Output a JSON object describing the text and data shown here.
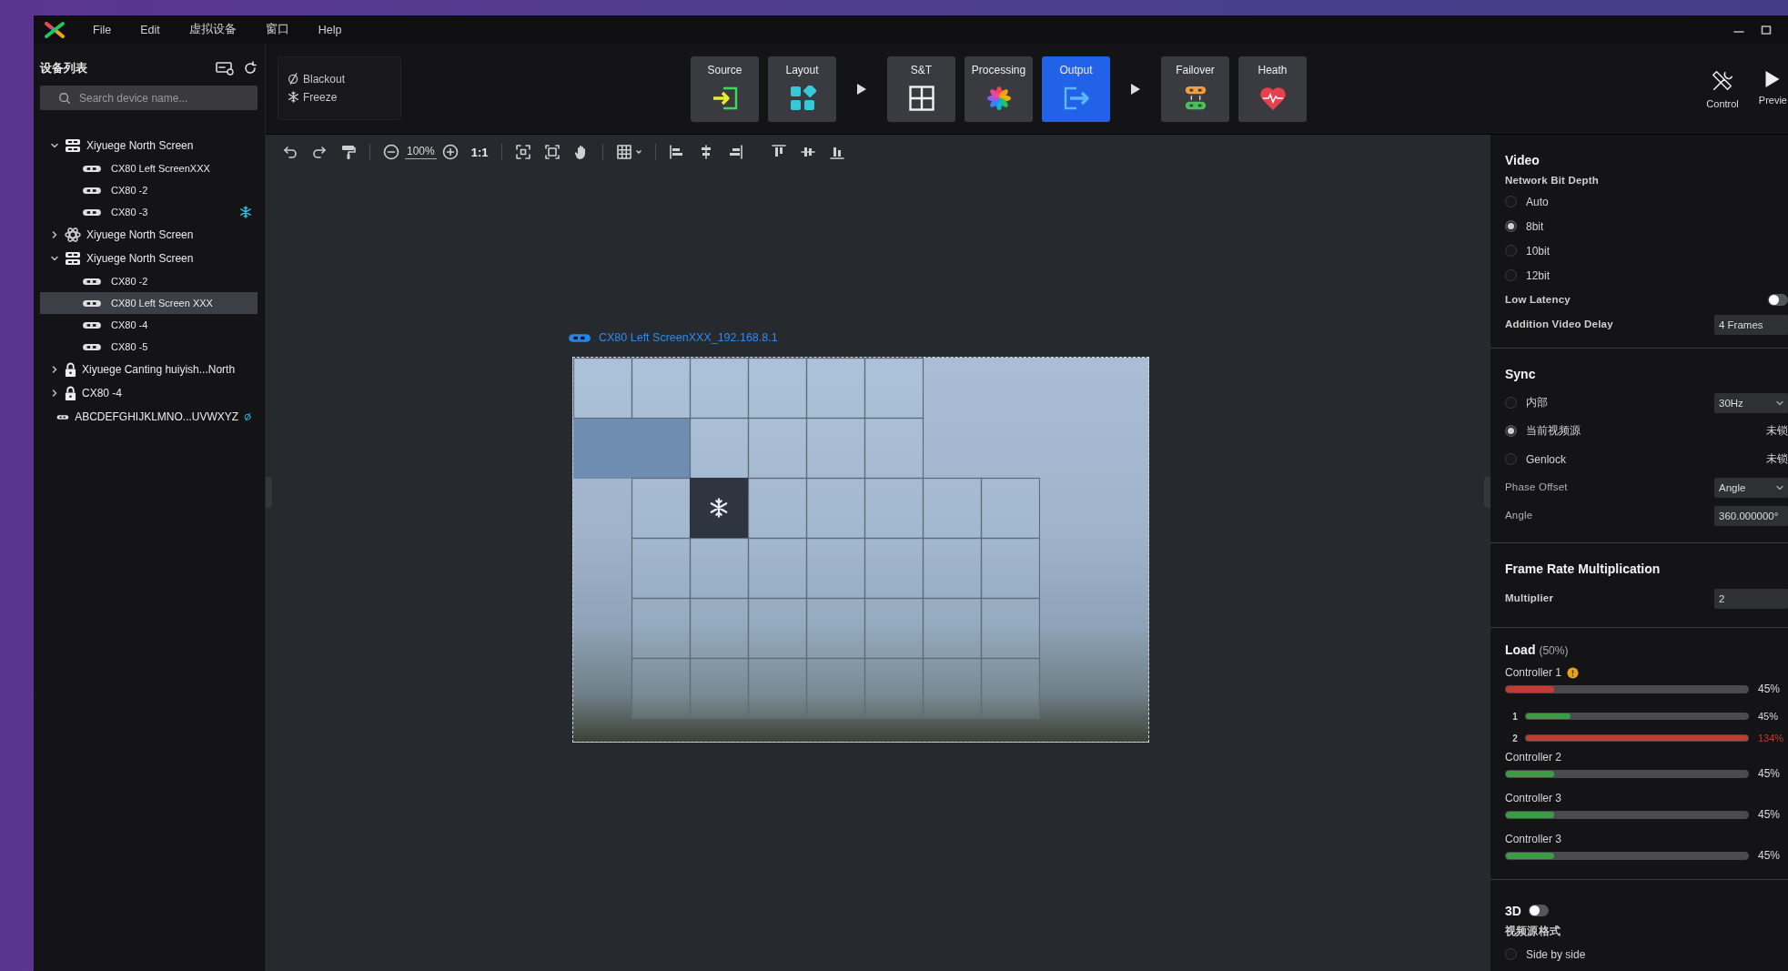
{
  "menu": [
    "File",
    "Edit",
    "虚拟设备",
    "窗口",
    "Help"
  ],
  "sidebar": {
    "title": "设备列表",
    "search": {
      "placeholder": "Search device name..."
    },
    "tree": [
      {
        "label": "Xiyuege North Screen",
        "kind": "group",
        "expanded": true,
        "selected": false,
        "frozen": false,
        "blackout": false,
        "children": [
          {
            "label": "CX80 Left ScreenXXX",
            "kind": "device",
            "selected": false,
            "frozen": false,
            "blackout": false
          },
          {
            "label": "CX80 -2",
            "kind": "device",
            "selected": false,
            "frozen": false,
            "blackout": false
          },
          {
            "label": "CX80 -3",
            "kind": "device",
            "selected": false,
            "frozen": true,
            "blackout": false
          }
        ]
      },
      {
        "label": "Xiyuege North Screen",
        "kind": "cluster",
        "expanded": false,
        "selected": false,
        "frozen": false,
        "blackout": false
      },
      {
        "label": "Xiyuege North Screen",
        "kind": "group",
        "expanded": true,
        "selected": false,
        "frozen": false,
        "blackout": false,
        "children": [
          {
            "label": "CX80 -2",
            "kind": "device",
            "selected": false,
            "frozen": false,
            "blackout": false
          },
          {
            "label": "CX80 Left Screen XXX",
            "kind": "device",
            "selected": true,
            "frozen": false,
            "blackout": false
          },
          {
            "label": "CX80 -4",
            "kind": "device",
            "selected": false,
            "frozen": false,
            "blackout": false
          },
          {
            "label": "CX80 -5",
            "kind": "device",
            "selected": false,
            "frozen": false,
            "blackout": false
          }
        ]
      },
      {
        "label": "Xiyuege Canting huiyish...North",
        "kind": "locked",
        "expanded": false,
        "selected": false,
        "frozen": false,
        "blackout": false
      },
      {
        "label": "CX80 -4",
        "kind": "locked",
        "expanded": false,
        "selected": false,
        "frozen": false,
        "blackout": false
      },
      {
        "label": "ABCDEFGHIJKLMNO...UVWXYZ",
        "kind": "device",
        "selected": false,
        "frozen": false,
        "blackout": true
      }
    ]
  },
  "quick_actions": [
    {
      "label": "Blackout",
      "kind": "blackout"
    },
    {
      "label": "Freeze",
      "kind": "freeze"
    }
  ],
  "pipeline": [
    {
      "label": "Source",
      "kind": "source",
      "selected": false
    },
    {
      "label": "Layout",
      "kind": "layout",
      "selected": false
    },
    {
      "kind": "arrow"
    },
    {
      "label": "S&T",
      "kind": "st",
      "selected": false
    },
    {
      "label": "Processing",
      "kind": "processing",
      "selected": false
    },
    {
      "label": "Output",
      "kind": "output",
      "selected": true
    },
    {
      "kind": "arrow"
    },
    {
      "label": "Failover",
      "kind": "failover",
      "selected": false
    },
    {
      "label": "Heath",
      "kind": "health",
      "selected": false
    }
  ],
  "tools": [
    {
      "label": "Control",
      "kind": "control"
    },
    {
      "label": "Previe",
      "kind": "preview"
    }
  ],
  "canvas": {
    "zoom": "100%",
    "actual_size": "1:1",
    "screen_label": "CX80 Left ScreenXXX_192.168.8.1"
  },
  "video": {
    "title": "Video",
    "bit_depth_label": "Network Bit Depth",
    "bit_depths": [
      {
        "label": "Auto",
        "selected": false
      },
      {
        "label": "8bit",
        "selected": true
      },
      {
        "label": "10bit",
        "selected": false
      },
      {
        "label": "12bit",
        "selected": false
      }
    ],
    "low_latency": {
      "label": "Low Latency",
      "on": false
    },
    "delay": {
      "label": "Addition Video Delay",
      "value": "4 Frames"
    }
  },
  "sync": {
    "title": "Sync",
    "sources": [
      {
        "label": "内部",
        "selected": false,
        "kind": "dropdown",
        "value": "30Hz"
      },
      {
        "label": "当前视频源",
        "selected": true,
        "kind": "status",
        "value": "未锁"
      },
      {
        "label": "Genlock",
        "selected": false,
        "kind": "status",
        "value": "未锁"
      }
    ],
    "phase_offset": {
      "label": "Phase Offset",
      "value": "Angle"
    },
    "angle": {
      "label": "Angle",
      "value": "360.000000°"
    }
  },
  "frame_rate": {
    "title": "Frame Rate Multiplication",
    "multiplier": {
      "label": "Multiplier",
      "value": "2"
    }
  },
  "load": {
    "title": "Load",
    "total": "(50%)",
    "controllers": [
      {
        "name": "Controller 1",
        "warning": true,
        "level": 0.2,
        "reading": "45%",
        "color": "#c23b32",
        "ports": [
          {
            "name": "1",
            "level": 0.2,
            "reading": "45%",
            "color": "#3d9a45"
          },
          {
            "name": "2",
            "level": 1,
            "reading": "134%",
            "color": "#c23b32"
          }
        ]
      },
      {
        "name": "Controller 2",
        "warning": false,
        "level": 0.2,
        "reading": "45%",
        "color": "#3d9a45"
      },
      {
        "name": "Controller 3",
        "warning": false,
        "level": 0.2,
        "reading": "45%",
        "color": "#3d9a45"
      },
      {
        "name": "Controller 3",
        "warning": false,
        "level": 0.2,
        "reading": "45%",
        "color": "#3d9a45"
      }
    ]
  },
  "stereo": {
    "label": "3D",
    "on": false,
    "format_label": "视频源格式",
    "formats": [
      {
        "label": "Side by side",
        "selected": false
      }
    ]
  }
}
